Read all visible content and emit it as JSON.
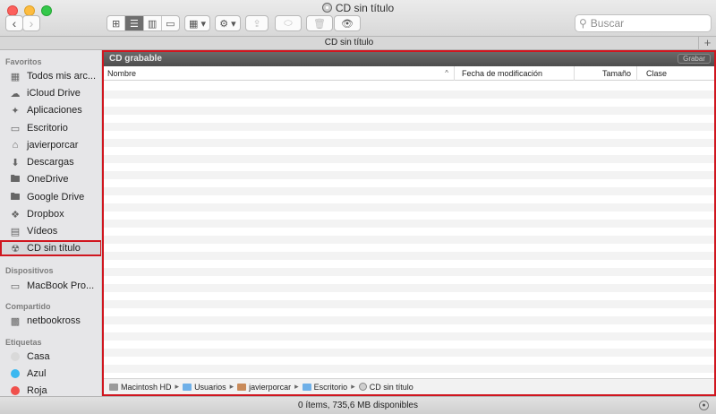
{
  "window": {
    "title": "CD sin título"
  },
  "toolbar": {
    "back_glyph": "‹",
    "forward_glyph": "›",
    "view_icon_glyph": "⊞",
    "view_list_glyph": "☰",
    "view_column_glyph": "▥",
    "view_coverflow_glyph": "▭",
    "arrange_glyph": "▦ ▾",
    "action_glyph": "⚙ ▾",
    "share_glyph": "⇪",
    "tag_glyph": "⬭",
    "trash_glyph": "🗑",
    "quicklook_glyph": "👁",
    "search_placeholder": "Buscar"
  },
  "tabbar": {
    "tab_label": "CD sin título",
    "add_glyph": "+"
  },
  "sidebar": {
    "favorites_header": "Favoritos",
    "favorites": [
      {
        "label": "Todos mis arc...",
        "icon": "all-files-icon"
      },
      {
        "label": "iCloud Drive",
        "icon": "cloud-icon"
      },
      {
        "label": "Aplicaciones",
        "icon": "applications-icon"
      },
      {
        "label": "Escritorio",
        "icon": "desktop-icon"
      },
      {
        "label": "javierporcar",
        "icon": "home-icon"
      },
      {
        "label": "Descargas",
        "icon": "downloads-icon"
      },
      {
        "label": "OneDrive",
        "icon": "folder-icon"
      },
      {
        "label": "Google Drive",
        "icon": "folder-icon"
      },
      {
        "label": "Dropbox",
        "icon": "dropbox-icon"
      },
      {
        "label": "Vídeos",
        "icon": "movies-icon"
      },
      {
        "label": "CD sin título",
        "icon": "cd-icon"
      }
    ],
    "devices_header": "Dispositivos",
    "devices": [
      {
        "label": "MacBook Pro...",
        "icon": "laptop-icon"
      }
    ],
    "shared_header": "Compartido",
    "shared": [
      {
        "label": "netbookross",
        "icon": "network-computer-icon"
      }
    ],
    "tags_header": "Etiquetas",
    "tags": [
      {
        "label": "Casa",
        "color": "#d9d9d9"
      },
      {
        "label": "Azul",
        "color": "#3ab8f0"
      },
      {
        "label": "Roja",
        "color": "#f0504c"
      }
    ]
  },
  "main": {
    "cd_bar_label": "CD grabable",
    "burn_button": "Grabar",
    "columns": {
      "name": "Nombre",
      "date": "Fecha de modificación",
      "size": "Tamaño",
      "kind": "Clase"
    },
    "sort_arrow": "^",
    "path": [
      {
        "label": "Macintosh HD",
        "icon": "hard-drive-icon"
      },
      {
        "label": "Usuarios",
        "icon": "folder-icon"
      },
      {
        "label": "javierporcar",
        "icon": "home-icon"
      },
      {
        "label": "Escritorio",
        "icon": "folder-icon"
      },
      {
        "label": "CD sin título",
        "icon": "cd-icon"
      }
    ],
    "path_separator": "▸"
  },
  "status": {
    "text": "0 ítems, 735,6 MB disponibles"
  },
  "colors": {
    "highlight_border": "#d0161f",
    "cd_bar": "#5a5a5a"
  }
}
